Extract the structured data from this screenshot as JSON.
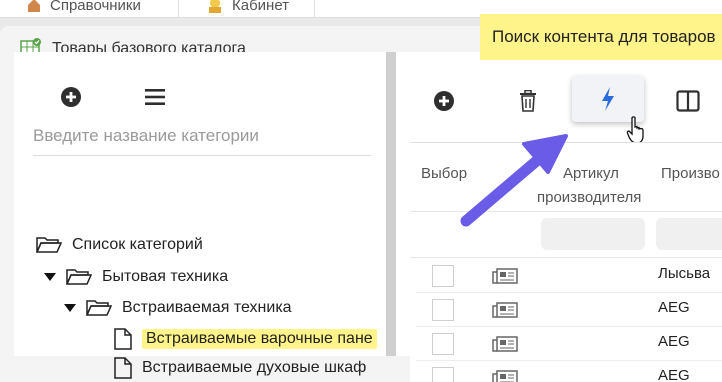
{
  "topnav": {
    "tab1_label": "Справочники",
    "tab2_label": "Кабинет"
  },
  "window": {
    "title": "Товары базового каталога"
  },
  "left": {
    "search_placeholder": "Введите название категории",
    "tree": [
      {
        "label": "Список категорий"
      },
      {
        "label": "Бытовая техника"
      },
      {
        "label": "Встраиваемая техника"
      },
      {
        "label": "Встраиваемые варочные пане"
      },
      {
        "label": "Встраиваемые духовые шкаф"
      }
    ]
  },
  "tooltip": {
    "text": "Поиск контента для товаров"
  },
  "table": {
    "col_select": "Выбор",
    "col_article_line1": "Артикул",
    "col_article_line2": "производителя",
    "col_maker": "Произво",
    "rows": [
      {
        "maker": "Лысьва"
      },
      {
        "maker": "AEG"
      },
      {
        "maker": "AEG"
      },
      {
        "maker": "AEG"
      }
    ]
  },
  "colors": {
    "highlight": "#fff48a",
    "arrow": "#6b5ce7",
    "active_icon": "#2b6be0"
  }
}
